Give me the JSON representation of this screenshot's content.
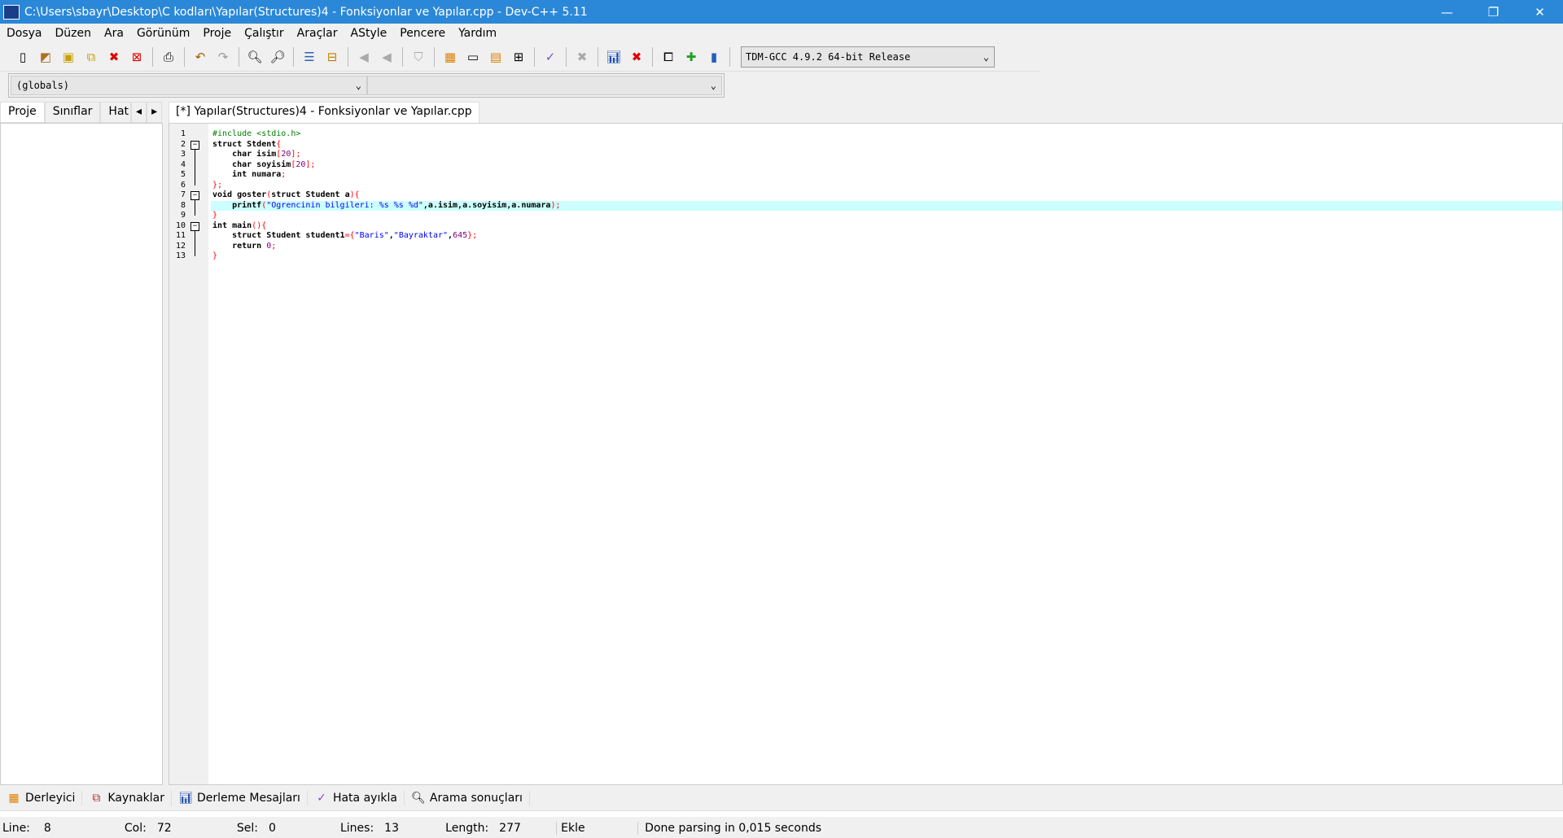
{
  "window": {
    "title": "C:\\Users\\sbayr\\Desktop\\C kodları\\Yapılar(Structures)4 - Fonksiyonlar ve Yapılar.cpp - Dev-C++ 5.11",
    "minimize": "—",
    "restore": "❐",
    "close": "✕"
  },
  "menu": [
    "Dosya",
    "Düzen",
    "Ara",
    "Görünüm",
    "Proje",
    "Çalıştır",
    "Araçlar",
    "AStyle",
    "Pencere",
    "Yardım"
  ],
  "toolbar": {
    "compiler": "TDM-GCC 4.9.2 64-bit Release"
  },
  "scope": {
    "left": "(globals)",
    "right": ""
  },
  "left_tabs": [
    "Proje",
    "Sınıflar",
    "Hat"
  ],
  "editor_tab": "[*] Yapılar(Structures)4 - Fonksiyonlar ve Yapılar.cpp",
  "code": [
    [
      [
        "#include <stdio.h>",
        "p"
      ]
    ],
    [
      [
        "struct Stdent",
        "k"
      ],
      [
        "{",
        "o"
      ]
    ],
    [
      [
        "    char isim",
        "k"
      ],
      [
        "[",
        "o"
      ],
      [
        "20",
        "n"
      ],
      [
        "];",
        "o"
      ]
    ],
    [
      [
        "    char soyisim",
        "k"
      ],
      [
        "[",
        "o"
      ],
      [
        "20",
        "n"
      ],
      [
        "];",
        "o"
      ]
    ],
    [
      [
        "    int numara",
        "k"
      ],
      [
        ";",
        "o"
      ]
    ],
    [
      [
        "};",
        "o"
      ]
    ],
    [
      [
        "void goster",
        "k"
      ],
      [
        "(",
        "o"
      ],
      [
        "struct Student a",
        "k"
      ],
      [
        "){",
        "o"
      ]
    ],
    [
      [
        "    printf",
        "k"
      ],
      [
        "(",
        "o"
      ],
      [
        "\"Ogrencinin bilgileri: %s %s %d\"",
        "s"
      ],
      [
        ",a.isim,a.soyisim,a.numara",
        "k"
      ],
      [
        ");",
        "o"
      ]
    ],
    [
      [
        "}",
        "o"
      ]
    ],
    [
      [
        "int main",
        "k"
      ],
      [
        "(){",
        "o"
      ]
    ],
    [
      [
        "    struct Student student1",
        "k"
      ],
      [
        "={",
        "o"
      ],
      [
        "\"Baris\"",
        "s"
      ],
      [
        ",",
        "k"
      ],
      [
        "\"Bayraktar\"",
        "s"
      ],
      [
        ",",
        "k"
      ],
      [
        "645",
        "n"
      ],
      [
        "};",
        "o"
      ]
    ],
    [
      [
        "    return ",
        "k"
      ],
      [
        "0",
        "n"
      ],
      [
        ";",
        "o"
      ]
    ],
    [
      [
        "}",
        "o"
      ]
    ]
  ],
  "highlight_line": 8,
  "bottom_tabs": [
    "Derleyici",
    "Kaynaklar",
    "Derleme Mesajları",
    "Hata ayıkla",
    "Arama sonuçları"
  ],
  "status": {
    "line_label": "Line:",
    "line": "8",
    "col_label": "Col:",
    "col": "72",
    "sel_label": "Sel:",
    "sel": "0",
    "lines_label": "Lines:",
    "lines": "13",
    "length_label": "Length:",
    "length": "277",
    "mode": "Ekle",
    "message": "Done parsing in 0,015 seconds"
  }
}
